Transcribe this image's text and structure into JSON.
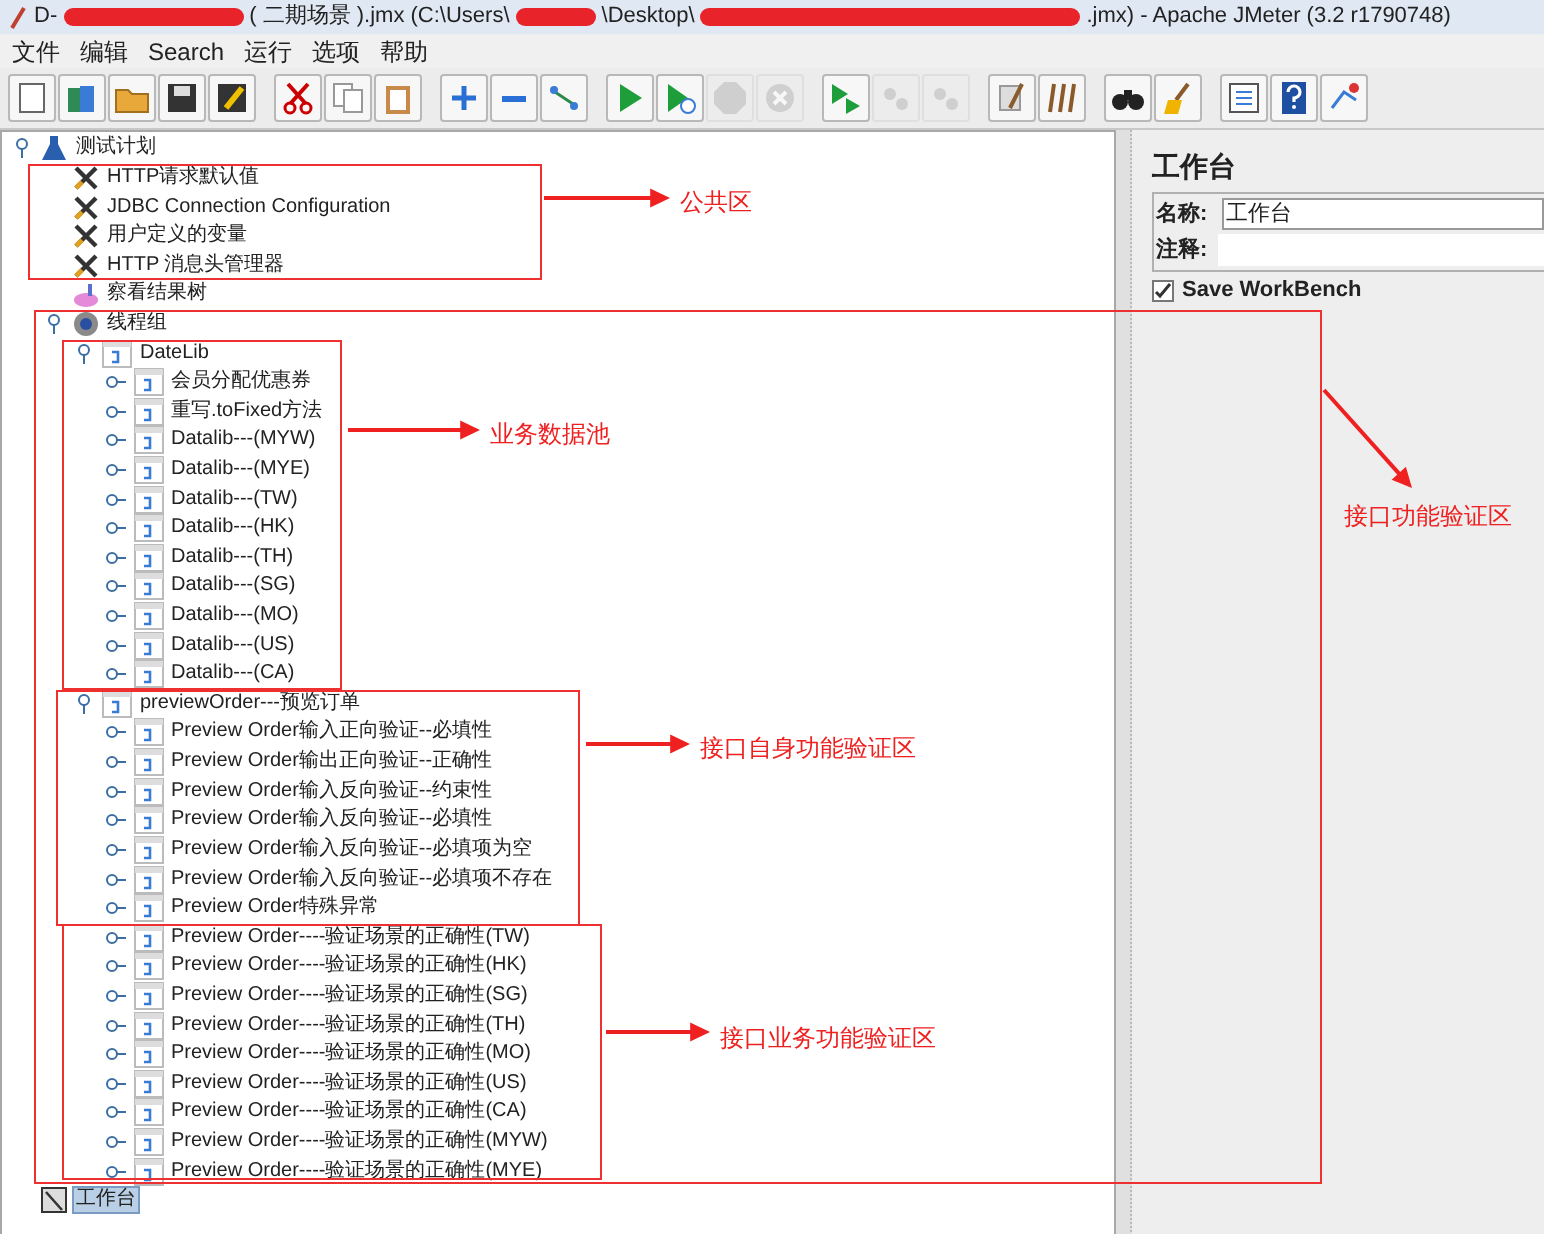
{
  "window": {
    "title_parts": [
      "D-",
      "( 二期场景 ).jmx (C:\\Users\\",
      "\\Desktop\\",
      ".jmx) - Apache JMeter (3.2 r1790748)"
    ]
  },
  "menu": [
    "文件",
    "编辑",
    "Search",
    "运行",
    "选项",
    "帮助"
  ],
  "toolbar": [
    {
      "kind": "new",
      "disabled": false
    },
    {
      "kind": "templates",
      "disabled": false
    },
    {
      "kind": "open",
      "disabled": false
    },
    {
      "kind": "save",
      "disabled": false
    },
    {
      "kind": "save-as",
      "disabled": false
    },
    {
      "kind": "cut",
      "disabled": false
    },
    {
      "kind": "copy",
      "disabled": false
    },
    {
      "kind": "paste",
      "disabled": false
    },
    {
      "kind": "expand",
      "disabled": false
    },
    {
      "kind": "collapse",
      "disabled": false
    },
    {
      "kind": "toggle",
      "disabled": false
    },
    {
      "kind": "start",
      "disabled": false
    },
    {
      "kind": "start-no-pause",
      "disabled": false
    },
    {
      "kind": "stop",
      "disabled": true
    },
    {
      "kind": "shutdown",
      "disabled": true
    },
    {
      "kind": "remote-start",
      "disabled": false
    },
    {
      "kind": "remote-stop",
      "disabled": true
    },
    {
      "kind": "remote-shutdown",
      "disabled": true
    },
    {
      "kind": "clear",
      "disabled": false
    },
    {
      "kind": "clear-all",
      "disabled": false
    },
    {
      "kind": "search",
      "disabled": false
    },
    {
      "kind": "reset-search",
      "disabled": false
    },
    {
      "kind": "functions",
      "disabled": false
    },
    {
      "kind": "help",
      "disabled": false
    },
    {
      "kind": "remote-log",
      "disabled": false
    }
  ],
  "tree": [
    {
      "kind": "plan",
      "label": "测试计划",
      "expanded": true,
      "selected": false,
      "children": [
        {
          "kind": "config",
          "label": "HTTP请求默认值",
          "selected": false
        },
        {
          "kind": "config",
          "label": "JDBC Connection Configuration",
          "selected": false
        },
        {
          "kind": "config",
          "label": "用户定义的变量",
          "selected": false
        },
        {
          "kind": "config",
          "label": "HTTP 消息头管理器",
          "selected": false
        },
        {
          "kind": "listener",
          "label": "察看结果树",
          "selected": false
        },
        {
          "kind": "thread-group",
          "label": "线程组",
          "expanded": true,
          "selected": false,
          "children": [
            {
              "kind": "fragment",
              "label": "DateLib",
              "expanded": true,
              "selected": false,
              "children": [
                {
                  "kind": "fragment",
                  "label": "会员分配优惠券",
                  "expanded": false,
                  "selected": false
                },
                {
                  "kind": "fragment",
                  "label": "重写.toFixed方法",
                  "expanded": false,
                  "selected": false
                },
                {
                  "kind": "fragment",
                  "label": "Datalib---(MYW)",
                  "expanded": false,
                  "selected": false
                },
                {
                  "kind": "fragment",
                  "label": "Datalib---(MYE)",
                  "expanded": false,
                  "selected": false
                },
                {
                  "kind": "fragment",
                  "label": "Datalib---(TW)",
                  "expanded": false,
                  "selected": false
                },
                {
                  "kind": "fragment",
                  "label": "Datalib---(HK)",
                  "expanded": false,
                  "selected": false
                },
                {
                  "kind": "fragment",
                  "label": "Datalib---(TH)",
                  "expanded": false,
                  "selected": false
                },
                {
                  "kind": "fragment",
                  "label": "Datalib---(SG)",
                  "expanded": false,
                  "selected": false
                },
                {
                  "kind": "fragment",
                  "label": "Datalib---(MO)",
                  "expanded": false,
                  "selected": false
                },
                {
                  "kind": "fragment",
                  "label": "Datalib---(US)",
                  "expanded": false,
                  "selected": false
                },
                {
                  "kind": "fragment",
                  "label": "Datalib---(CA)",
                  "expanded": false,
                  "selected": false
                }
              ]
            },
            {
              "kind": "fragment",
              "label": "previewOrder---预览订单",
              "expanded": true,
              "selected": false,
              "children": [
                {
                  "kind": "fragment",
                  "label": "Preview Order输入正向验证--必填性",
                  "expanded": false,
                  "selected": false
                },
                {
                  "kind": "fragment",
                  "label": "Preview Order输出正向验证--正确性",
                  "expanded": false,
                  "selected": false
                },
                {
                  "kind": "fragment",
                  "label": "Preview Order输入反向验证--约束性",
                  "expanded": false,
                  "selected": false
                },
                {
                  "kind": "fragment",
                  "label": "Preview Order输入反向验证--必填性",
                  "expanded": false,
                  "selected": false
                },
                {
                  "kind": "fragment",
                  "label": "Preview Order输入反向验证--必填项为空",
                  "expanded": false,
                  "selected": false
                },
                {
                  "kind": "fragment",
                  "label": "Preview Order输入反向验证--必填项不存在",
                  "expanded": false,
                  "selected": false
                },
                {
                  "kind": "fragment",
                  "label": "Preview Order特殊异常",
                  "expanded": false,
                  "selected": false
                },
                {
                  "kind": "fragment",
                  "label": "Preview Order----验证场景的正确性(TW)",
                  "expanded": false,
                  "selected": false
                },
                {
                  "kind": "fragment",
                  "label": "Preview Order----验证场景的正确性(HK)",
                  "expanded": false,
                  "selected": false
                },
                {
                  "kind": "fragment",
                  "label": "Preview Order----验证场景的正确性(SG)",
                  "expanded": false,
                  "selected": false
                },
                {
                  "kind": "fragment",
                  "label": "Preview Order----验证场景的正确性(TH)",
                  "expanded": false,
                  "selected": false
                },
                {
                  "kind": "fragment",
                  "label": "Preview Order----验证场景的正确性(MO)",
                  "expanded": false,
                  "selected": false
                },
                {
                  "kind": "fragment",
                  "label": "Preview Order----验证场景的正确性(US)",
                  "expanded": false,
                  "selected": false
                },
                {
                  "kind": "fragment",
                  "label": "Preview Order----验证场景的正确性(CA)",
                  "expanded": false,
                  "selected": false
                },
                {
                  "kind": "fragment",
                  "label": "Preview Order----验证场景的正确性(MYW)",
                  "expanded": false,
                  "selected": false
                },
                {
                  "kind": "fragment",
                  "label": "Preview Order----验证场景的正确性(MYE)",
                  "expanded": false,
                  "selected": false
                }
              ]
            }
          ]
        }
      ]
    },
    {
      "kind": "workbench",
      "label": "工作台",
      "selected": true
    }
  ],
  "panel": {
    "title": "工作台",
    "name_label": "名称:",
    "name_value": "工作台",
    "comment_label": "注释:",
    "save_workbench": {
      "label": "Save WorkBench",
      "checked": true
    }
  },
  "annotations": [
    {
      "label": "公共区"
    },
    {
      "label": "业务数据池"
    },
    {
      "label": "接口功能验证区"
    },
    {
      "label": "接口自身功能验证区"
    },
    {
      "label": "接口业务功能验证区"
    }
  ]
}
